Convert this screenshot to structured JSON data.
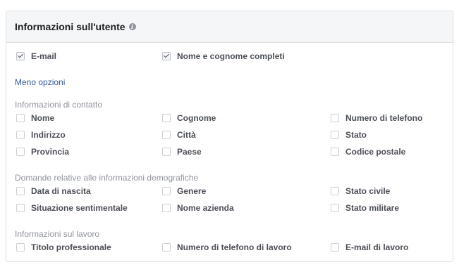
{
  "header": {
    "title": "Informazioni sull'utente",
    "info_icon": "info-icon"
  },
  "standard_fields": [
    {
      "label": "E-mail",
      "checked": true
    },
    {
      "label": "Nome e cognome completi",
      "checked": true
    }
  ],
  "less_options_link": "Meno opzioni",
  "sections": [
    {
      "title": "Informazioni di contatto",
      "rows": [
        [
          "Nome",
          "Cognome",
          "Numero di telefono"
        ],
        [
          "Indirizzo",
          "Città",
          "Stato"
        ],
        [
          "Provincia",
          "Paese",
          "Codice postale"
        ]
      ]
    },
    {
      "title": "Domande relative alle informazioni demografiche",
      "rows": [
        [
          "Data di nascita",
          "Genere",
          "Stato civile"
        ],
        [
          "Situazione sentimentale",
          "Nome azienda",
          "Stato militare"
        ]
      ]
    },
    {
      "title": "Informazioni sul lavoro",
      "rows": [
        [
          "Titolo professionale",
          "Numero di telefono di lavoro",
          "E-mail di lavoro"
        ]
      ]
    }
  ]
}
